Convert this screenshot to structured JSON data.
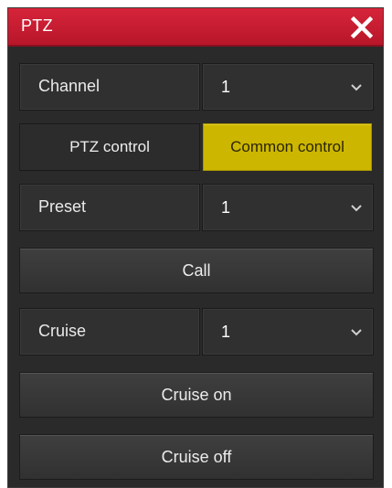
{
  "window": {
    "title": "PTZ",
    "close_icon": "close-x-icon",
    "accent_color": "#c81d31"
  },
  "channel": {
    "label": "Channel",
    "value": "1"
  },
  "tabs": {
    "ptz_control": "PTZ control",
    "common_control": "Common control",
    "active": "Common control",
    "active_color": "#cdb600"
  },
  "preset": {
    "label": "Preset",
    "value": "1",
    "call_button": "Call"
  },
  "cruise": {
    "label": "Cruise",
    "value": "1",
    "on_button": "Cruise on",
    "off_button": "Cruise off"
  }
}
